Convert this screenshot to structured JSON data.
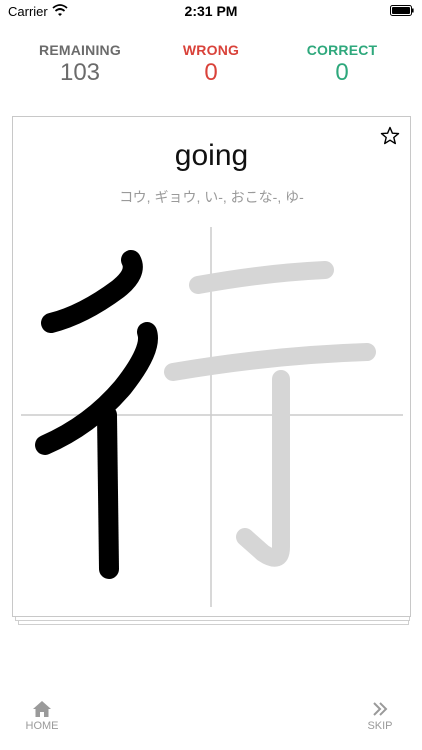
{
  "status_bar": {
    "carrier": "Carrier",
    "time": "2:31 PM",
    "wifi_icon": "wifi-icon",
    "battery_icon": "battery-icon"
  },
  "stats": {
    "remaining": {
      "label": "REMAINING",
      "value": "103",
      "color": "#6b6b6b"
    },
    "wrong": {
      "label": "WRONG",
      "value": "0",
      "color": "#d9423a"
    },
    "correct": {
      "label": "CORRECT",
      "value": "0",
      "color": "#2ea87c"
    }
  },
  "card": {
    "meaning": "going",
    "readings": "コウ, ギョウ, い-, おこな-, ゆ-",
    "star_icon": "star-outline-icon",
    "stroke_color_done": "#000000",
    "stroke_color_guide": "#d6d6d6",
    "grid_color": "#cccccc"
  },
  "tabs": {
    "home": {
      "label": "HOME",
      "icon": "home-icon"
    },
    "skip": {
      "label": "SKIP",
      "icon": "double-chevron-right-icon"
    }
  }
}
